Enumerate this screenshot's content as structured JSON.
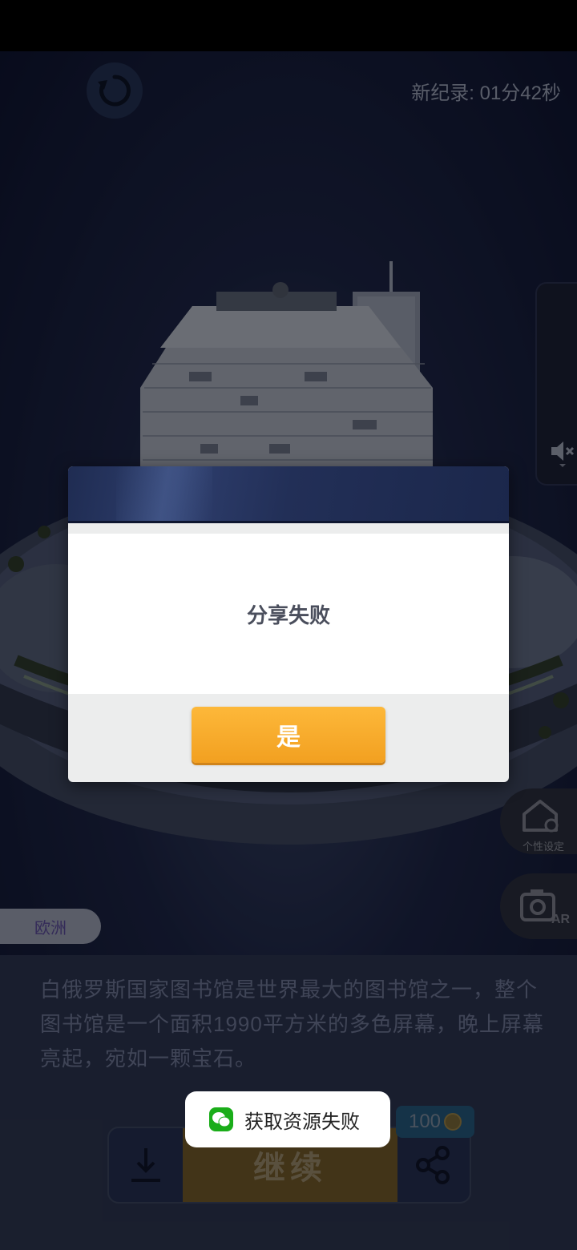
{
  "hud": {
    "record_text": "新纪录: 01分42秒"
  },
  "side": {
    "home_label": "个性设定"
  },
  "region": {
    "label": "欧洲"
  },
  "description": {
    "text": "白俄罗斯国家图书馆是世界最大的图书馆之一，整个图书馆是一个面积1990平方米的多色屏幕，晚上屏幕亮起，宛如一颗宝石。"
  },
  "actions": {
    "continue_label": "继续",
    "coin_count": "100"
  },
  "dialog": {
    "message": "分享失败",
    "confirm_label": "是"
  },
  "toast": {
    "message": "获取资源失败"
  },
  "icons": [
    "refresh-icon",
    "mute-icon",
    "home-settings-icon",
    "ar-camera-icon",
    "download-icon",
    "share-icon",
    "coin-icon",
    "wechat-icon"
  ],
  "colors": {
    "dialog_button": "#f5a623",
    "scene_background": "#1d2546",
    "toast_icon": "#1aad19"
  }
}
